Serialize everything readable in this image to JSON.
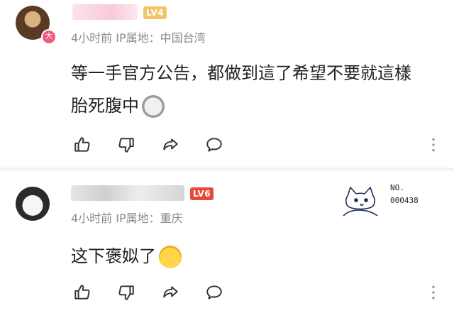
{
  "comments": [
    {
      "avatar_badge": "大",
      "level": "LV4",
      "meta": "4小时前  IP属地：中国台湾",
      "text_line1": "等一手官方公告，都做到這了希望不要就這樣",
      "text_line2": "胎死腹中",
      "emoji": "grimace-face-emoji"
    },
    {
      "level": "LV6",
      "meta": "4小时前  IP属地：重庆",
      "text": "这下褒姒了",
      "emoji": "crying-face-emoji",
      "sticker": {
        "label": "NO.",
        "number": "000438"
      }
    }
  ],
  "icons": {
    "like": "thumbs-up-icon",
    "dislike": "thumbs-down-icon",
    "share": "share-icon",
    "reply": "comment-icon",
    "more": "more-icon"
  },
  "colors": {
    "text": "#222222",
    "meta": "#8a8a8a",
    "lv4": "#f2c46a",
    "lv6": "#e8483a",
    "badge": "#f05a7e"
  }
}
